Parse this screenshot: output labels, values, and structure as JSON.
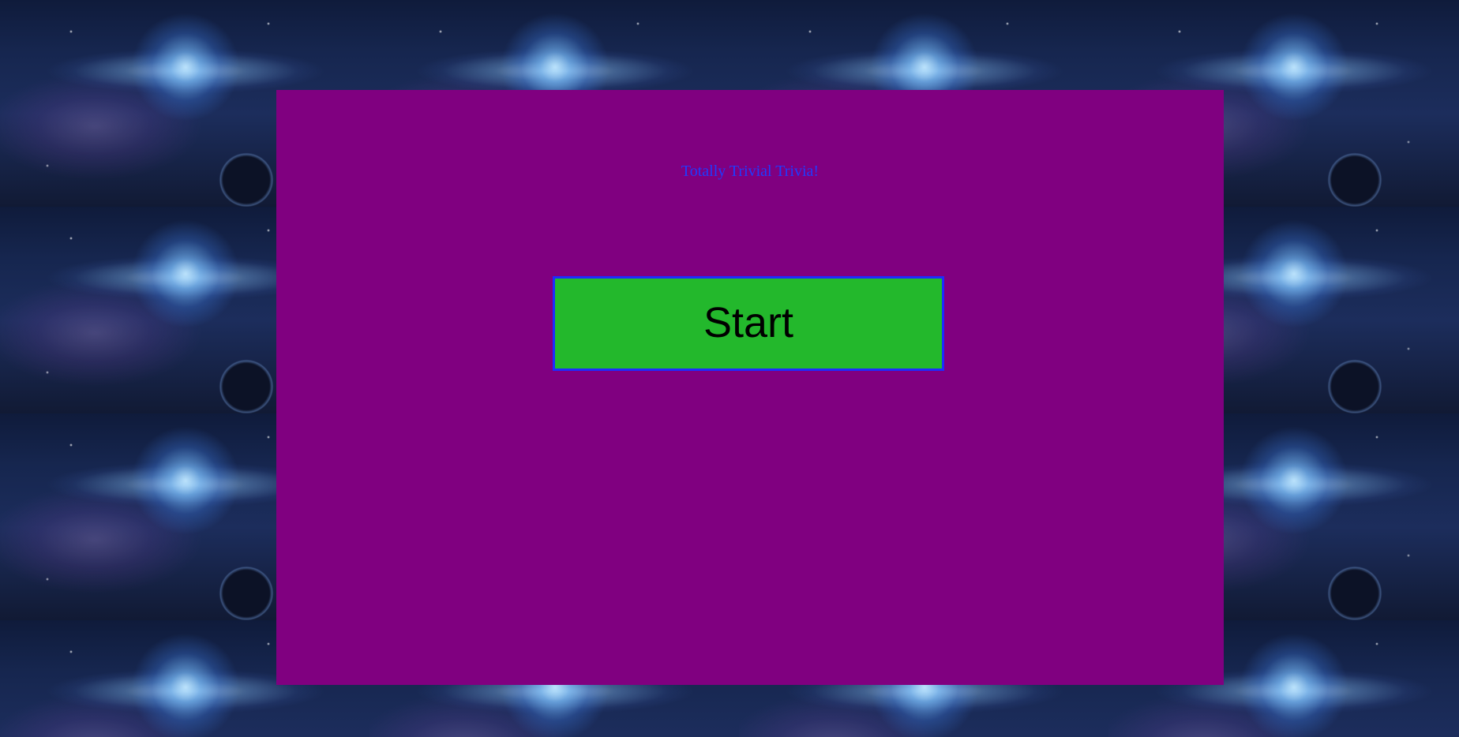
{
  "app": {
    "title": "Totally Trivial Trivia!"
  },
  "home": {
    "start_button_label": "Start"
  },
  "colors": {
    "panel_background": "#800080",
    "title_text": "#1f3bff",
    "start_button_background": "#23b82c",
    "start_button_border": "#1d2cff",
    "start_button_text": "#000000"
  }
}
